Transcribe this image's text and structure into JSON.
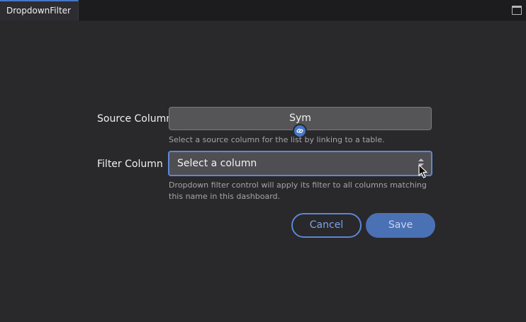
{
  "tab": {
    "label": "DropdownFilter"
  },
  "source": {
    "label": "Source Column",
    "value": "Sym",
    "help": "Select a source column for the list by linking to a table."
  },
  "filter": {
    "label": "Filter Column",
    "value": "Select a column",
    "help": "Dropdown filter control will apply its filter to all columns matching this name in this dashboard."
  },
  "buttons": {
    "cancel": "Cancel",
    "save": "Save"
  },
  "colors": {
    "accent": "#4677c8",
    "background": "#29282b",
    "primary_button": "#4b71b5"
  },
  "icons": {
    "maximize": "maximize-icon",
    "link": "link-icon",
    "sort": "sort-arrows-icon",
    "cursor": "pointer-cursor-icon"
  }
}
